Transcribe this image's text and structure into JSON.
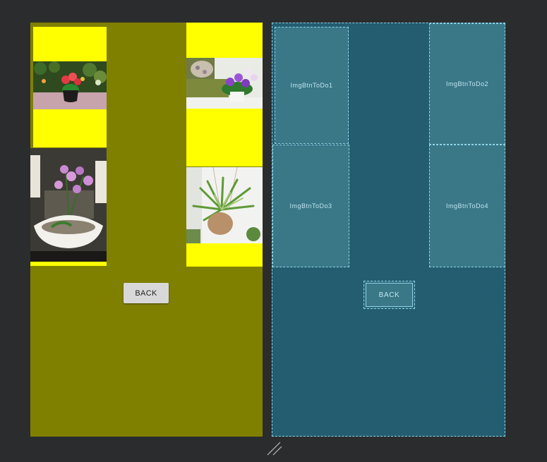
{
  "design": {
    "back_label": "BACK",
    "background_color": "#808000",
    "image_frame_color": "#ffff00",
    "images": [
      {
        "id": "imgbtn1",
        "subject": "red flowers in dark pot"
      },
      {
        "id": "imgbtn2",
        "subject": "purple african violet on armchair"
      },
      {
        "id": "imgbtn3",
        "subject": "pink orchid in white shell bowl"
      },
      {
        "id": "imgbtn4",
        "subject": "spider plant in hanging pot"
      }
    ]
  },
  "blueprint": {
    "background_color": "#235d6f",
    "labels": {
      "btn1": "ImgBtnToDo1",
      "btn2": "ImgBtnToDo2",
      "btn3": "ImgBtnToDo3",
      "btn4": "ImgBtnToDo4",
      "back": "BACK"
    }
  }
}
